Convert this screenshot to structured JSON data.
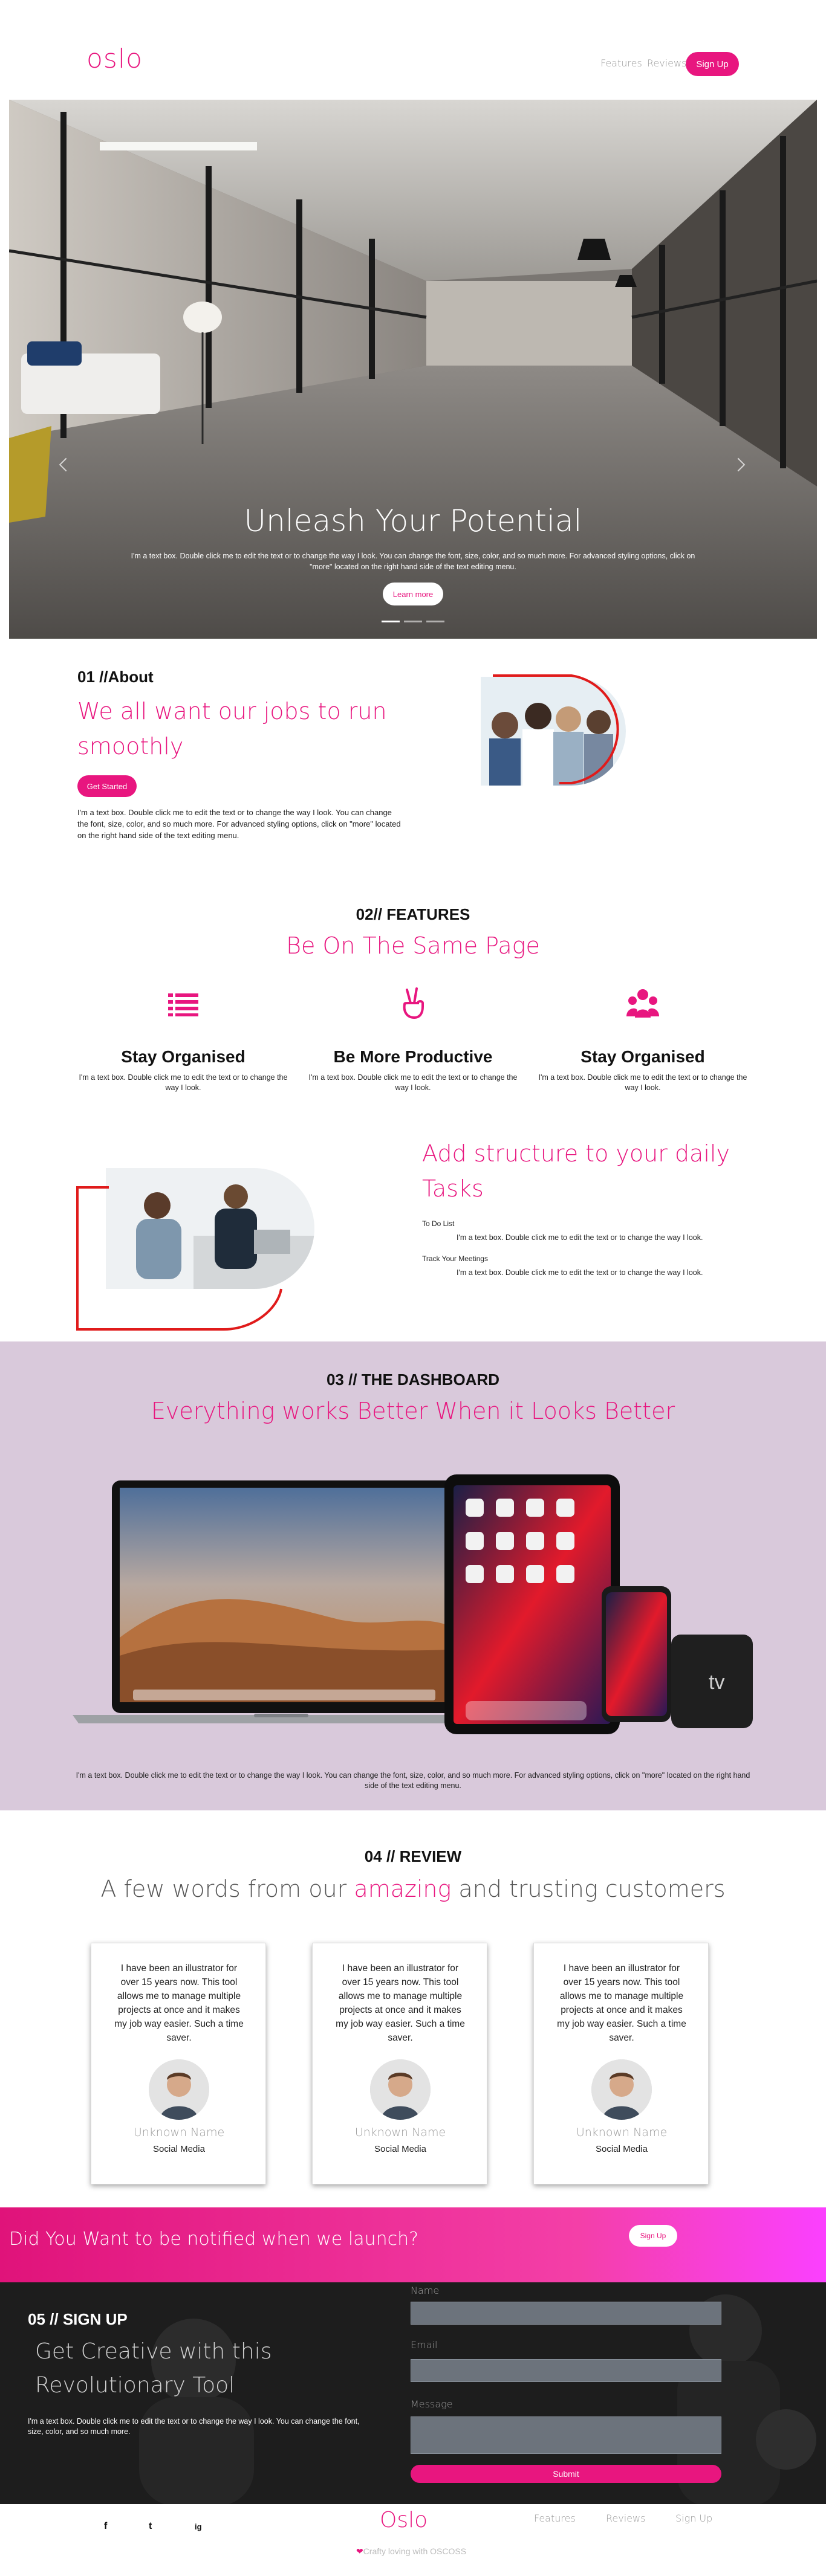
{
  "header": {
    "logo": "oslo",
    "nav": [
      "Features",
      "Reviews"
    ],
    "signup": "Sign Up"
  },
  "hero": {
    "title": "Unleash Your Potential",
    "text": "I'm a text box. Double click me to edit the text or to change the way I look. You can change the font, size, color, and so much more. For advanced styling options, click on \"more\" located on the right hand side of the text editing menu.",
    "button": "Learn more",
    "slides": 3
  },
  "about": {
    "number": "01 //About",
    "title": "We all want our jobs to run smoothly",
    "button": "Get Started",
    "text": "I'm a text box. Double click me to edit the text or to change the way I look. You can change the font, size, color, and so much more. For advanced styling options, click on \"more\" located on the right hand side of the text editing menu."
  },
  "features": {
    "number": "02// FEATURES",
    "title": "Be On The Same Page",
    "items": [
      {
        "icon": "list-icon",
        "title": "Stay Organised",
        "text": "I'm a text box. Double click me to edit the text or to change the way I look."
      },
      {
        "icon": "peace-hand-icon",
        "title": "Be More Productive",
        "text": "I'm a text box. Double click me to edit the text or to change the way I look."
      },
      {
        "icon": "team-icon",
        "title": "Stay Organised",
        "text": "I'm a text box. Double click me to edit the text or to change the way I look."
      }
    ]
  },
  "structure": {
    "title": "Add structure to your daily Tasks",
    "items": [
      {
        "label": "To Do List",
        "text": "I'm a text box. Double click me to edit the text or to change the way I look."
      },
      {
        "label": "Track Your Meetings",
        "text": "I'm a text box. Double click me to edit the text or to change the way I look."
      }
    ]
  },
  "dashboard": {
    "number": "03 // THE DASHBOARD",
    "title": "Everything works Better When it Looks Better",
    "text": "I'm a text box. Double click me to edit the text or to change the way I look. You can change the font, size, color, and so much more. For advanced styling options, click on \"more\" located on the right hand side of the text editing menu.",
    "device_label": "tv"
  },
  "review": {
    "number": "04 // REVIEW",
    "title_before": "A few words from our ",
    "title_highlight": "amazing",
    "title_after": " and trusting customers",
    "cards": [
      {
        "text": "I have been an illustrator for over 15 years now. This tool allows me to manage multiple projects at once and it makes my job way easier. Such a time saver.",
        "name": "Unknown Name",
        "role": "Social Media"
      },
      {
        "text": "I have been an illustrator for over 15 years now. This tool allows me to manage multiple projects at once and it makes my job way easier. Such a time saver.",
        "name": "Unknown Name",
        "role": "Social Media"
      },
      {
        "text": "I have been an illustrator for over 15 years now. This tool allows me to manage multiple projects at once and it makes my job way easier. Such a time saver.",
        "name": "Unknown Name",
        "role": "Social Media"
      }
    ]
  },
  "notify": {
    "text": "Did You Want to be notified when we launch?",
    "button": "Sign Up"
  },
  "signup": {
    "number": "05 // SIGN UP",
    "title": "Get Creative with this Revolutionary Tool",
    "text": "I'm a text box. Double click me to edit the text or to change the way I look. You can change the font, size, color, and so much more.",
    "fields": [
      "Name",
      "Email",
      "Message"
    ],
    "submit": "Submit"
  },
  "footer": {
    "social": [
      "f",
      "t",
      "ig"
    ],
    "logo": "Oslo",
    "credit": "Crafty loving with OSCOSS",
    "links": [
      "Features",
      "Reviews",
      "Sign Up"
    ]
  },
  "colors": {
    "accent": "#e8167f",
    "dashboard_bg": "#d9c9db",
    "dark": "#1c1c1c"
  }
}
